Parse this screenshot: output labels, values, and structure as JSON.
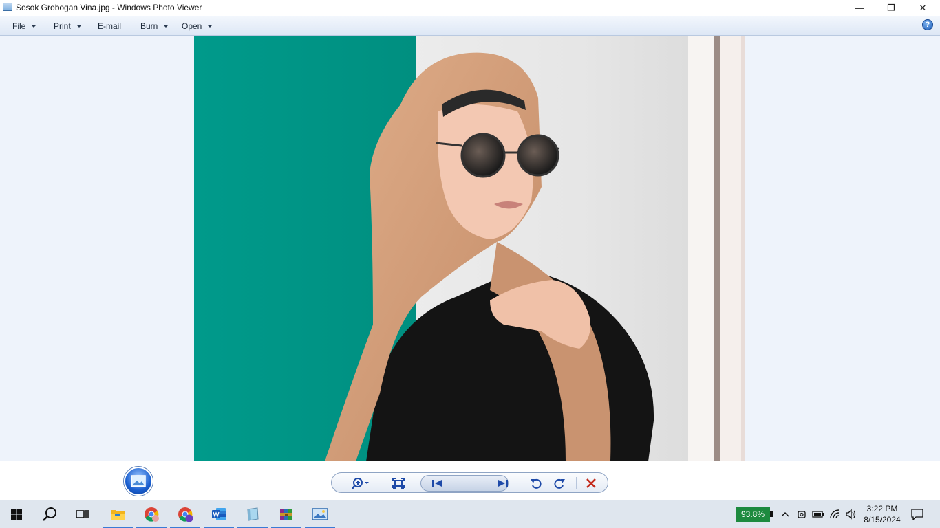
{
  "window": {
    "title": "Sosok Grobogan Vina.jpg - Windows Photo Viewer",
    "minimize_glyph": "—",
    "restore_glyph": "❐",
    "close_glyph": "✕"
  },
  "menu": {
    "items": [
      {
        "label": "File",
        "dropdown": true
      },
      {
        "label": "Print",
        "dropdown": true
      },
      {
        "label": "E-mail",
        "dropdown": false
      },
      {
        "label": "Burn",
        "dropdown": true
      },
      {
        "label": "Open",
        "dropdown": true
      }
    ],
    "help_glyph": "?"
  },
  "photo": {
    "colors": {
      "teal": "#00998a",
      "wall": "#ececec",
      "scarf": "#d6a27d",
      "skin": "#f2c4ac",
      "sweater": "#121212"
    }
  },
  "controls": {
    "icons": [
      "zoom-icon",
      "fit-to-window-icon",
      "previous-icon",
      "slideshow-icon",
      "next-icon",
      "rotate-counterclockwise-icon",
      "rotate-clockwise-icon",
      "delete-icon"
    ],
    "delete_color": "#c42b1c"
  },
  "taskbar": {
    "apps": [
      "start",
      "search",
      "task-view",
      "file-explorer",
      "chrome",
      "chrome-profile",
      "word",
      "notepad",
      "winrar",
      "photo-viewer"
    ],
    "battery_percent": "93.8%",
    "time": "3:22 PM",
    "date": "8/15/2024",
    "battery_color": "#1d8a3e"
  }
}
